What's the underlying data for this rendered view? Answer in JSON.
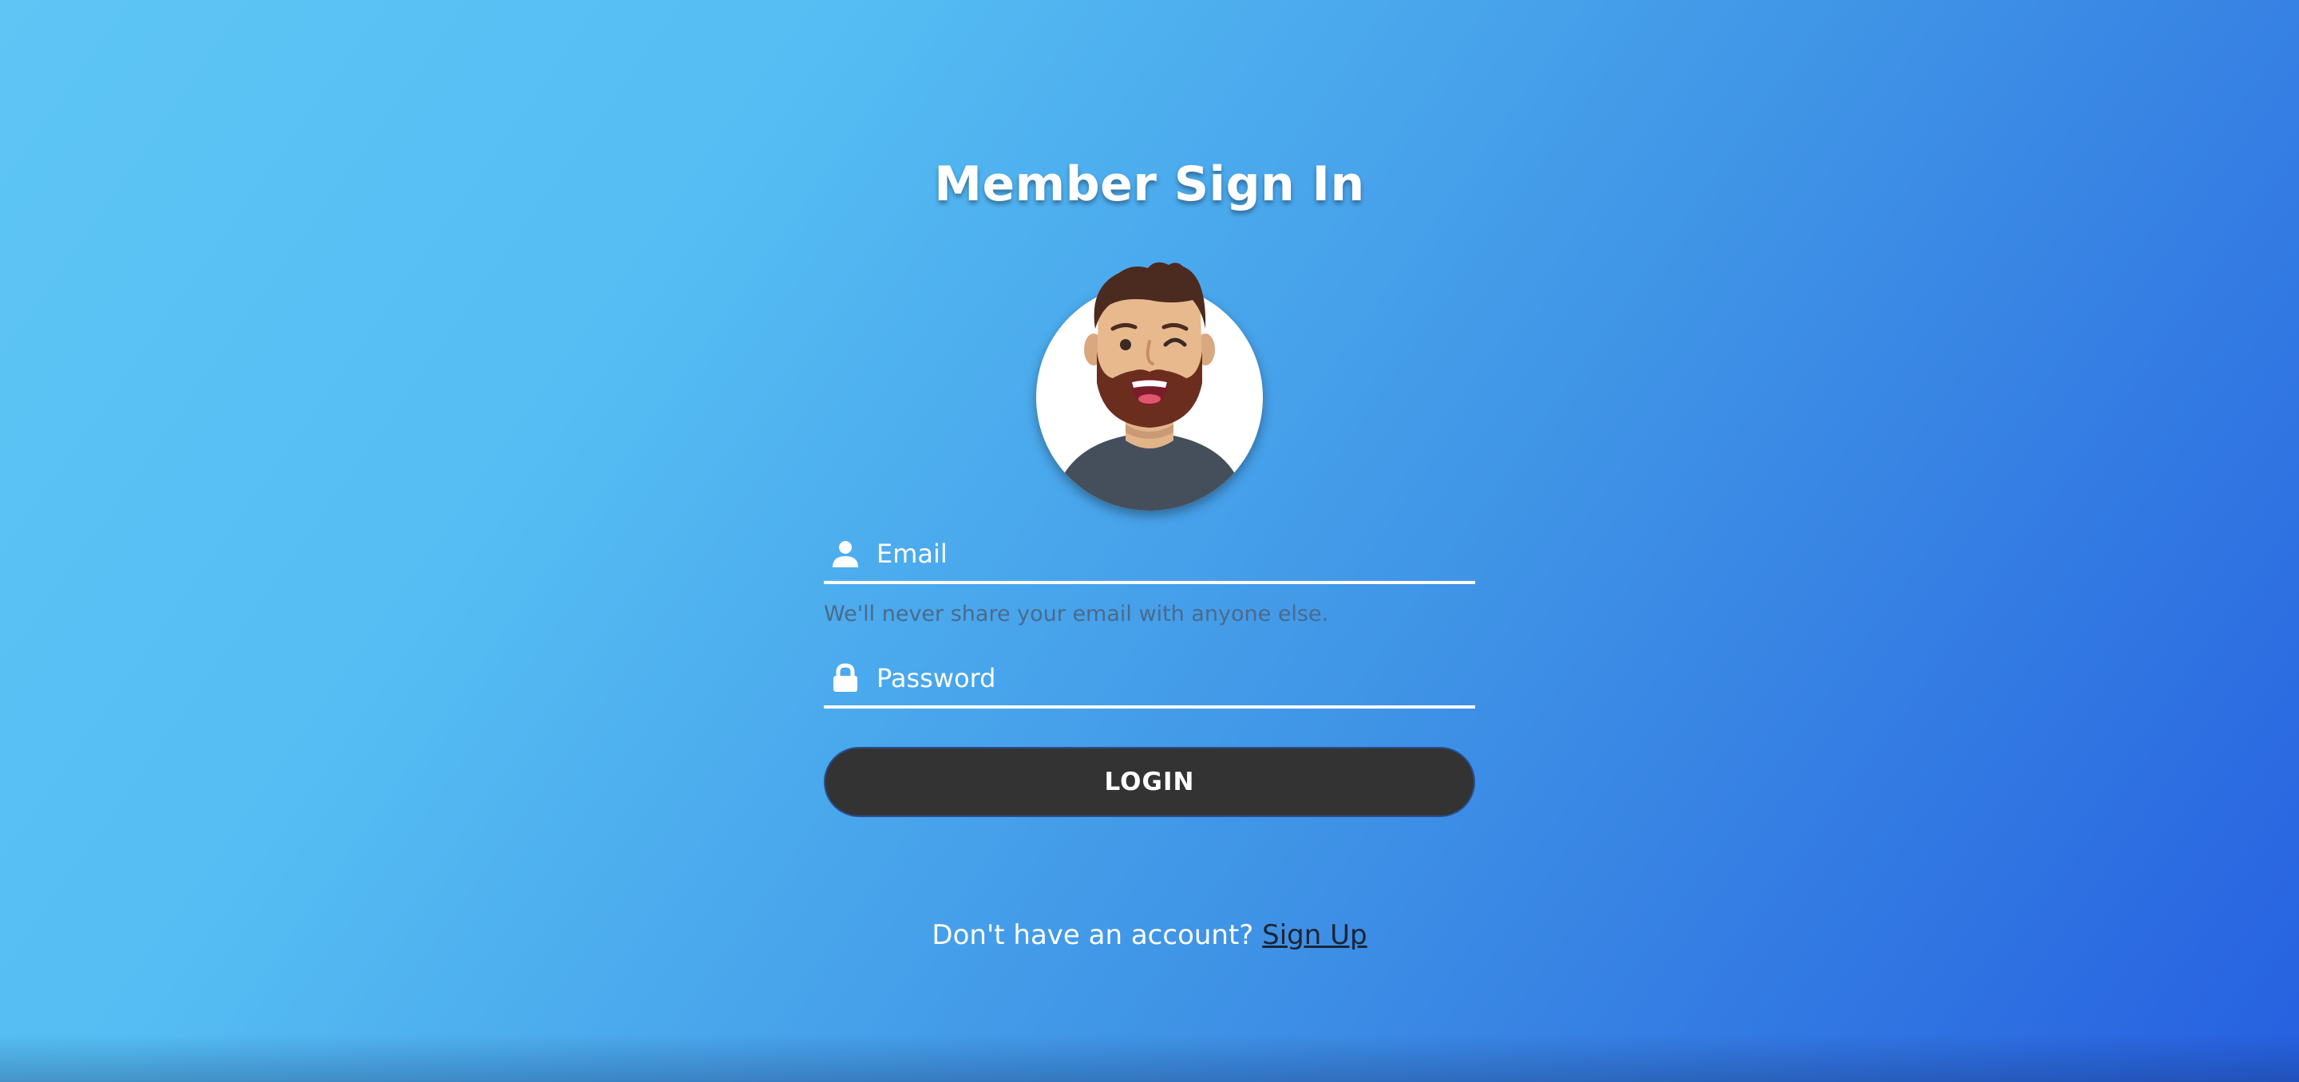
{
  "page": {
    "title": "Member Sign In"
  },
  "form": {
    "email": {
      "placeholder": "Email",
      "value": "",
      "icon": "user-icon",
      "hint": "We'll never share your email with anyone else."
    },
    "password": {
      "placeholder": "Password",
      "value": "",
      "icon": "lock-icon"
    },
    "login_label": "LOGIN"
  },
  "footer": {
    "prompt": "Don't have an account?",
    "signup_label": "Sign Up"
  },
  "colors": {
    "gradient_start": "#5ec5f5",
    "gradient_end": "#2660e0",
    "button_bg": "#333333",
    "hint_text": "#4b6a8c"
  }
}
